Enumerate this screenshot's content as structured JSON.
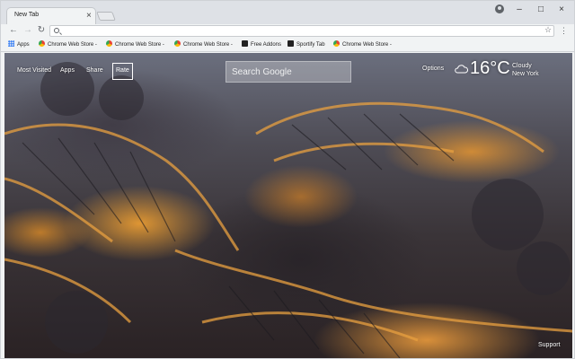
{
  "tab": {
    "title": "New Tab",
    "close_glyph": "×"
  },
  "window_controls": {
    "minimize": "–",
    "maximize": "□",
    "close": "×"
  },
  "toolbar": {
    "back": "←",
    "forward": "→",
    "reload": "↻",
    "omnibox_value": "",
    "star": "☆",
    "menu": "⋮"
  },
  "bookmarks": [
    {
      "label": "Apps",
      "icon": "apps-icon"
    },
    {
      "label": "Chrome Web Store -",
      "icon": "chrome-web-store-icon"
    },
    {
      "label": "Chrome Web Store -",
      "icon": "chrome-web-store-icon"
    },
    {
      "label": "Chrome Web Store -",
      "icon": "chrome-web-store-icon"
    },
    {
      "label": "Free Addons",
      "icon": "addon-icon"
    },
    {
      "label": "Sportify Tab",
      "icon": "addon-icon"
    },
    {
      "label": "Chrome Web Store -",
      "icon": "chrome-web-store-icon"
    }
  ],
  "newtab": {
    "nav": {
      "most_visited": "Most Visited",
      "apps": "Apps",
      "share": "Share",
      "rate": "Rate"
    },
    "search_placeholder": "Search Google",
    "options": "Options",
    "weather": {
      "temperature": "16°",
      "unit": "C",
      "condition": "Cloudy",
      "city": "New York",
      "icon": "cloud-icon"
    },
    "support": "Support"
  },
  "colors": {
    "accent_orange": "#e89a3a",
    "dark_bg": "#3a3438",
    "chrome_frame": "#dee1e6"
  }
}
